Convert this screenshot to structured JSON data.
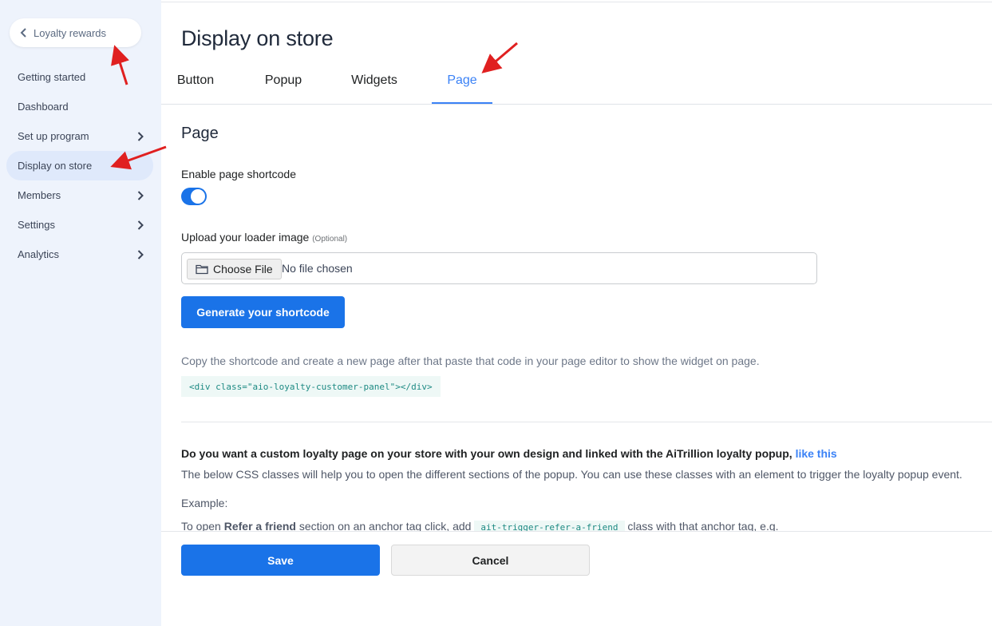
{
  "sidebar": {
    "back_label": "Loyalty rewards",
    "items": [
      {
        "label": "Getting started",
        "has_arrow": false,
        "active": false
      },
      {
        "label": "Dashboard",
        "has_arrow": false,
        "active": false
      },
      {
        "label": "Set up program",
        "has_arrow": true,
        "active": false
      },
      {
        "label": "Display on store",
        "has_arrow": false,
        "active": true
      },
      {
        "label": "Members",
        "has_arrow": true,
        "active": false
      },
      {
        "label": "Settings",
        "has_arrow": true,
        "active": false
      },
      {
        "label": "Analytics",
        "has_arrow": true,
        "active": false
      }
    ]
  },
  "header": {
    "title": "Display on store",
    "tabs": [
      {
        "label": "Button"
      },
      {
        "label": "Popup"
      },
      {
        "label": "Widgets"
      },
      {
        "label": "Page",
        "active": true
      }
    ]
  },
  "main": {
    "section_title": "Page",
    "shortcode_label": "Enable page shortcode",
    "shortcode_enabled": true,
    "loader_label": "Upload your loader image",
    "loader_optional": "(Optional)",
    "choose_file_label": "Choose File",
    "no_file_text": "No file chosen",
    "generate_label": "Generate your shortcode",
    "help_text": "Copy the shortcode and create a new page after that paste that code in your page editor to show the widget on page.",
    "shortcode": "<div class=\"aio-loyalty-customer-panel\"></div>",
    "custom_question": "Do you want a custom loyalty page on your store with your own design and linked with the AiTrillion loyalty popup,",
    "like_this": "like this",
    "description": "The below CSS classes will help you to open the different sections of the popup. You can use these classes with an element to trigger the loyalty popup event.",
    "example_label": "Example:",
    "example_line": {
      "prefix": "To open",
      "bold": "Refer a friend",
      "middle": "section on an anchor tag click, add",
      "code": "ait-trigger-refer-a-friend",
      "suffix": "class with that anchor tag, e.g."
    }
  },
  "footer": {
    "save_label": "Save",
    "cancel_label": "Cancel"
  },
  "colors": {
    "primary": "#1a73e8",
    "tab_active": "#3b82f6",
    "sidebar_bg": "#eef3fc",
    "annotation_arrow": "#e02020"
  }
}
